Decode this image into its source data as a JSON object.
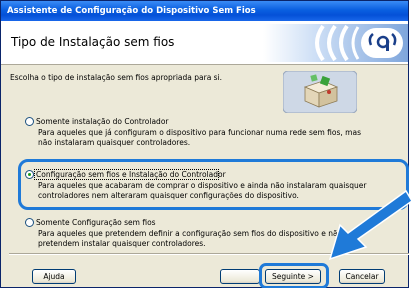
{
  "window": {
    "title": "Assistente de Configuração do Dispositivo Sem Fios"
  },
  "header": {
    "title": "Tipo de Instalação sem fios",
    "logo_icon": "wireless-signal-icon"
  },
  "description": "Escolha o tipo de instalação sem fios apropriada para si.",
  "hero_image": "wireless-setup-box-icon",
  "options": [
    {
      "label": "Somente instalação do Controlador",
      "detail_lines": [
        "Para aqueles que já configuram o dispositivo para funcionar numa rede sem fios, mas",
        "não instalaram quaisquer controladores."
      ],
      "selected": false
    },
    {
      "label": "Configuração sem fios e Instalação do Controlador",
      "detail_lines": [
        "Para aqueles que acabaram de comprar o dispositivo e ainda não instalaram quaisquer",
        "controladores nem alteraram quaisquer configurações do dispositivo."
      ],
      "selected": true
    },
    {
      "label": "Somente Configuração sem fios",
      "detail_lines": [
        "Para aqueles que pretendem definir a configuração sem fios do dispositivo e não",
        "pretendem instalar quaisquer controladores."
      ],
      "selected": false
    }
  ],
  "buttons": {
    "help": "Ajuda",
    "back": "",
    "next": "Seguinte >",
    "cancel": "Cancelar"
  },
  "colors": {
    "highlight": "#1f7ad8",
    "titlebar": "#0a5fe0",
    "dialog_bg": "#ece9d8"
  }
}
